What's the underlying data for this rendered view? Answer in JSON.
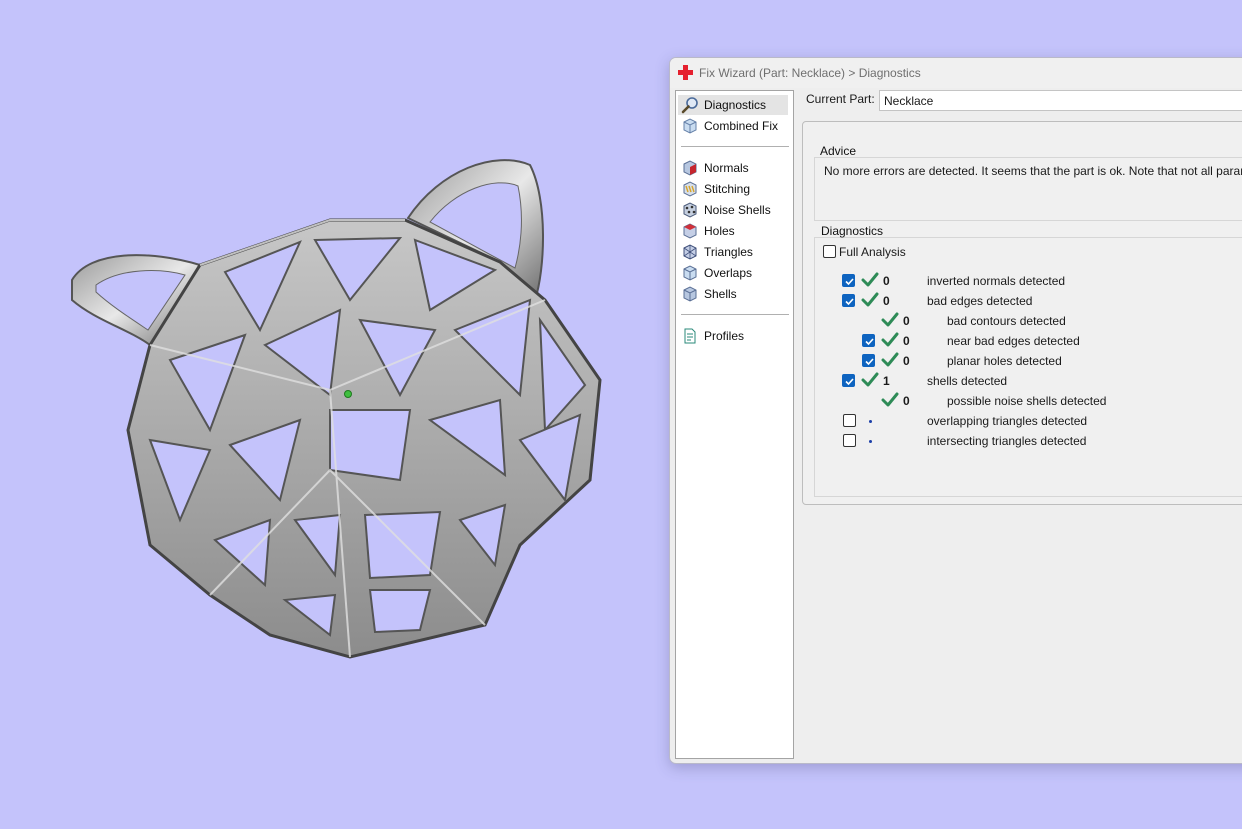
{
  "window": {
    "title": "Fix Wizard (Part: Necklace) > Diagnostics"
  },
  "nav": {
    "items": [
      {
        "label": "Diagnostics",
        "icon": "magnifier-icon"
      },
      {
        "label": "Combined Fix",
        "icon": "combined-fix-icon"
      },
      {
        "label": "Normals",
        "icon": "normals-icon"
      },
      {
        "label": "Stitching",
        "icon": "stitching-icon"
      },
      {
        "label": "Noise Shells",
        "icon": "noise-shells-icon"
      },
      {
        "label": "Holes",
        "icon": "holes-icon"
      },
      {
        "label": "Triangles",
        "icon": "triangles-icon"
      },
      {
        "label": "Overlaps",
        "icon": "overlaps-icon"
      },
      {
        "label": "Shells",
        "icon": "shells-icon"
      },
      {
        "label": "Profiles",
        "icon": "profiles-icon"
      }
    ],
    "active": "Diagnostics"
  },
  "current_part": {
    "label": "Current Part:",
    "value": "Necklace"
  },
  "advice": {
    "title": "Advice",
    "text": "No more errors are detected. It seems that the part is ok. Note that not all parameters"
  },
  "diagnostics": {
    "title": "Diagnostics",
    "full_analysis": {
      "label": "Full Analysis",
      "checked": false
    },
    "rows": [
      {
        "checked": true,
        "status": "ok",
        "count": "0",
        "label": "inverted normals detected"
      },
      {
        "checked": true,
        "status": "ok",
        "count": "0",
        "label": "bad edges detected"
      },
      {
        "checked": null,
        "status": "ok",
        "count": "0",
        "label": "bad contours detected"
      },
      {
        "checked": true,
        "status": "ok",
        "count": "0",
        "label": "near bad edges detected"
      },
      {
        "checked": true,
        "status": "ok",
        "count": "0",
        "label": "planar holes detected"
      },
      {
        "checked": true,
        "status": "ok",
        "count": "1",
        "label": "shells detected"
      },
      {
        "checked": null,
        "status": "ok",
        "count": "0",
        "label": "possible noise shells detected"
      },
      {
        "checked": false,
        "status": "not-run",
        "count": "",
        "label": "overlapping triangles detected"
      },
      {
        "checked": false,
        "status": "not-run",
        "count": "",
        "label": "intersecting triangles detected"
      }
    ]
  },
  "colors": {
    "background": "#c4c3fb",
    "check_ok": "#2e8b57",
    "checkbox_on": "#0e64c0",
    "title_icon": "#e5202e"
  }
}
